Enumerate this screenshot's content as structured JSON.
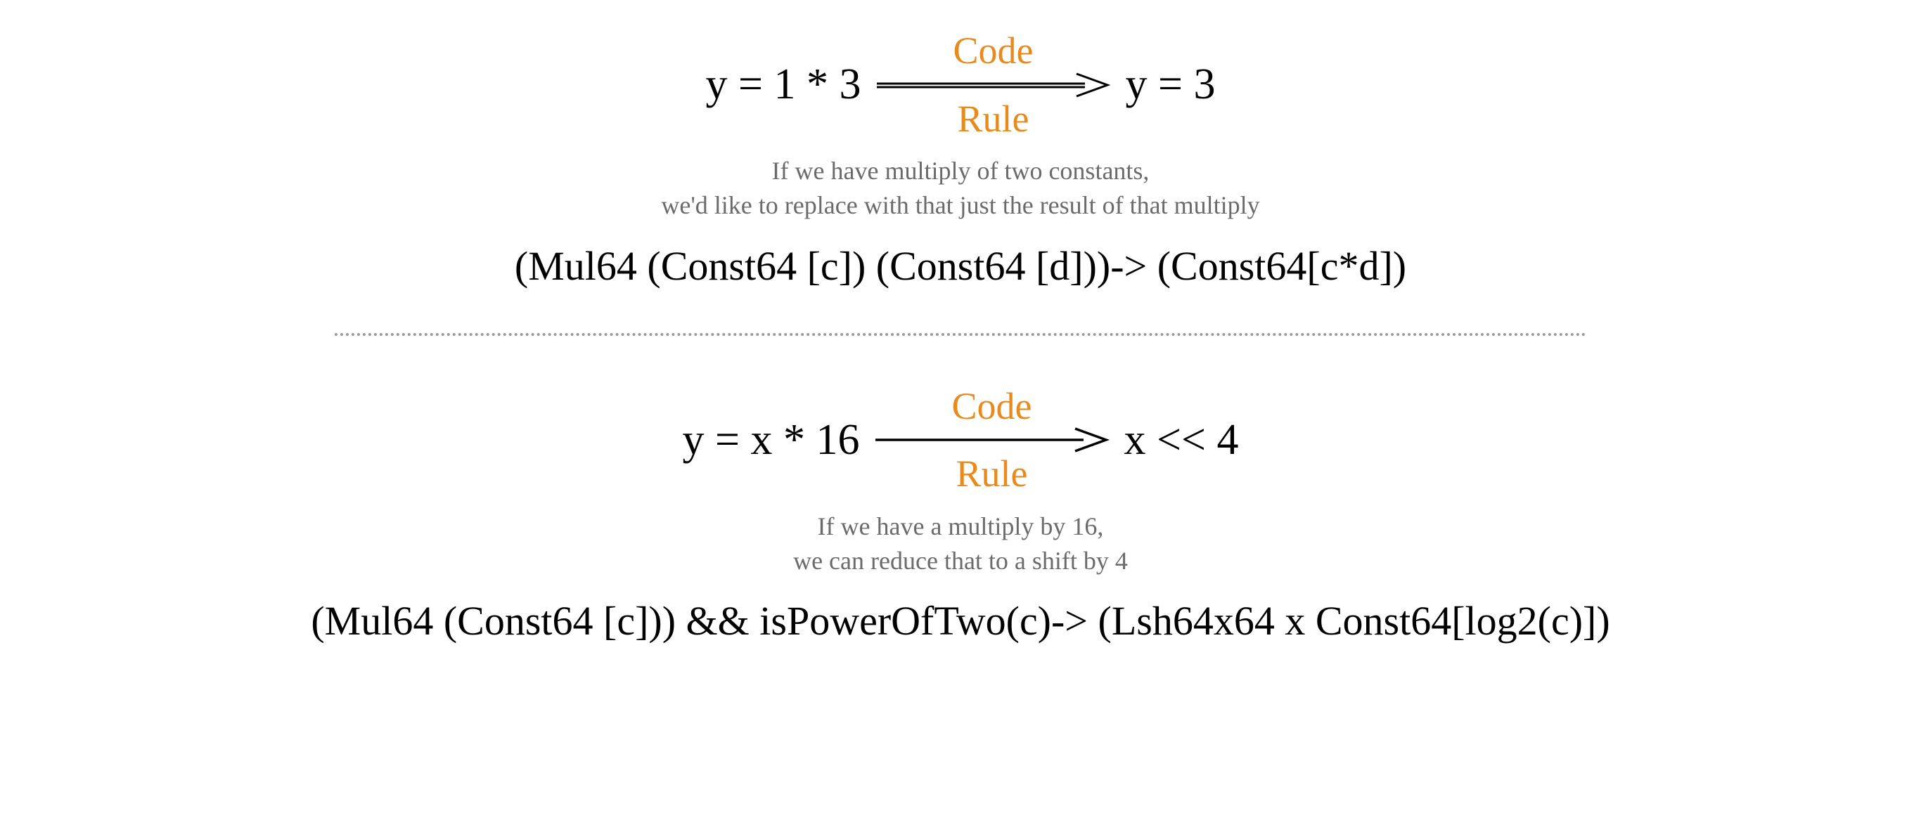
{
  "section1": {
    "code_label": "Code",
    "rule_label": "Rule",
    "lhs": "y = 1 * 3",
    "rhs": "y = 3",
    "description": "If we have multiply of two constants,\nwe'd like to replace with that just the result of that multiply",
    "rule_text": "(Mul64 (Const64 [c]) (Const64 [d]))-> (Const64[c*d])"
  },
  "section2": {
    "code_label": "Code",
    "rule_label": "Rule",
    "lhs": "y = x * 16",
    "rhs": "x << 4",
    "description": "If we have a multiply by 16,\nwe can reduce that to a shift by 4",
    "rule_text": "(Mul64 (Const64 [c])) && isPowerOfTwo(c)-> (Lsh64x64 x Const64[log2(c)])"
  }
}
